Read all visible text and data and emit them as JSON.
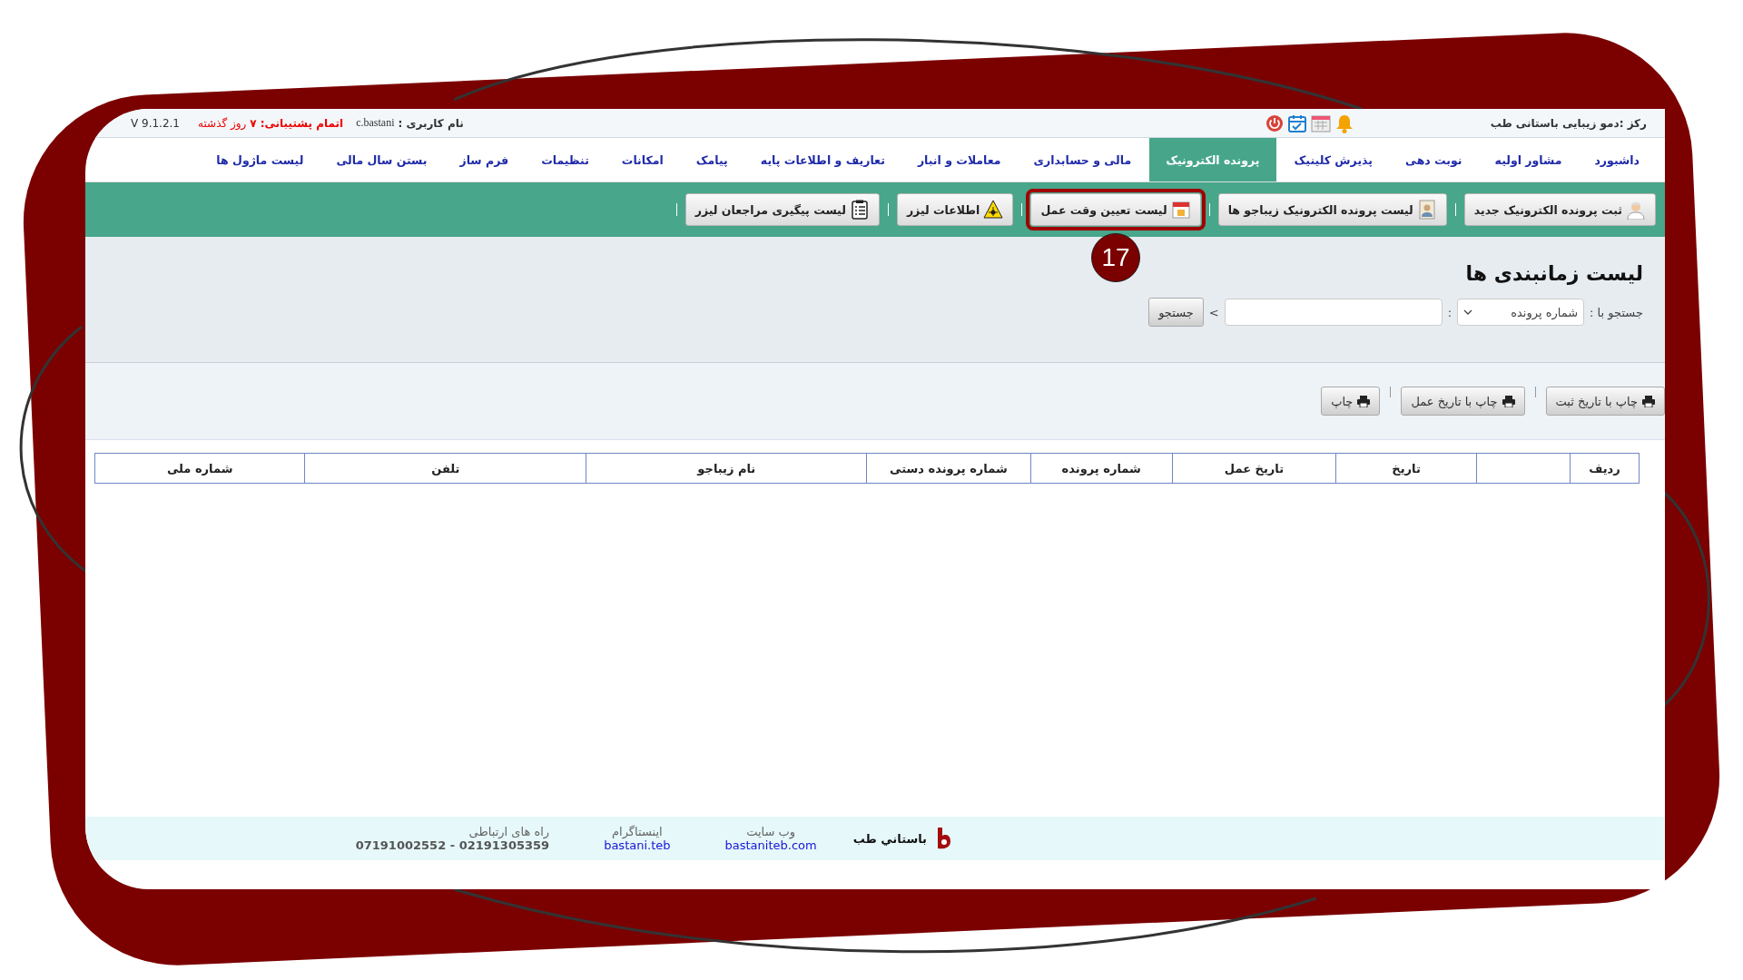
{
  "header": {
    "center_name": "رکز :دمو زیبایی باستانی طب",
    "user_label": "نام کاربری :",
    "username": "c.bastani",
    "support_status": "**اتمام پشتیبانی: ۷** روز گذشته",
    "version": "V 9.1.2.1"
  },
  "menu": [
    {
      "label": "داشبورد",
      "selected": false
    },
    {
      "label": "مشاور اولیه",
      "selected": false
    },
    {
      "label": "نوبت دهی",
      "selected": false
    },
    {
      "label": "پذیرش کلینیک",
      "selected": false
    },
    {
      "label": "پرونده الکترونیک",
      "selected": true
    },
    {
      "label": "مالی و حسابداری",
      "selected": false
    },
    {
      "label": "معاملات و انبار",
      "selected": false
    },
    {
      "label": "تعاریف و اطلاعات پایه",
      "selected": false
    },
    {
      "label": "پیامک",
      "selected": false
    },
    {
      "label": "امکانات",
      "selected": false
    },
    {
      "label": "تنظیمات",
      "selected": false
    },
    {
      "label": "فرم ساز",
      "selected": false
    },
    {
      "label": "بستن سال مالی",
      "selected": false
    },
    {
      "label": "لیست ماژول ها",
      "selected": false
    }
  ],
  "toolbar": [
    {
      "label": "ثبت پرونده الکترونیک جدید",
      "highlighted": false
    },
    {
      "label": "لیست پرونده الکترونیک زیباجو ها",
      "highlighted": false
    },
    {
      "label": "لیست تعیین وقت عمل",
      "highlighted": true,
      "badge": "17"
    },
    {
      "label": "اطلاعات لیزر",
      "highlighted": false
    },
    {
      "label": "لیست پیگیری مراجعان لیزر",
      "highlighted": false
    }
  ],
  "panel": {
    "title": "لیست زمانبندی ها",
    "search_label": "جستجو با :",
    "search_by": "شماره پرونده",
    "colon": ":",
    "arrow": ">",
    "button": "جستجو"
  },
  "print_buttons": [
    "چاپ با تاریخ ثبت",
    "چاپ با تاریخ عمل",
    "چاپ"
  ],
  "table": {
    "columns": [
      {
        "label": "ردیف"
      },
      {},
      {
        "label": "تاریخ"
      },
      {
        "label": "تاریخ عمل"
      },
      {
        "label": "شماره پرونده"
      },
      {
        "label": "شماره پرونده دستی"
      },
      {
        "label": "نام زیباجو"
      },
      {
        "label": "تلفن"
      },
      {
        "label": "شماره ملی"
      }
    ]
  },
  "footer": {
    "brand": "باستاني طب",
    "contacts": [
      {
        "heading": "وب سایت",
        "value": "bastaniteb.com",
        "kind": "link"
      },
      {
        "heading": "اینستاگرام",
        "value": "bastani.teb",
        "kind": "link"
      },
      {
        "heading": "راه های ارتباطی",
        "value": "07191002552 - 02191305359",
        "kind": "phone"
      }
    ]
  }
}
